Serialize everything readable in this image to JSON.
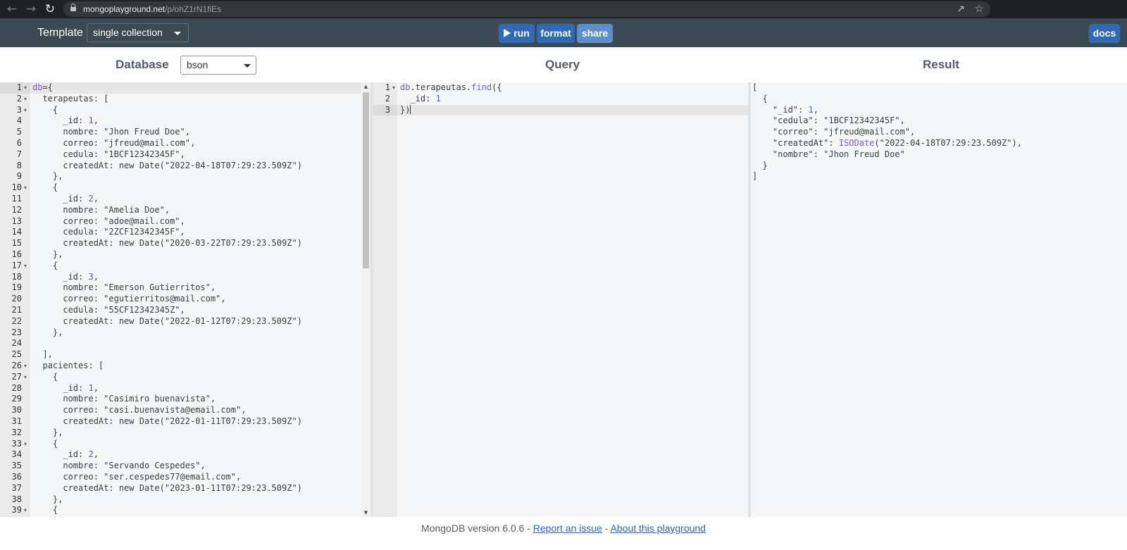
{
  "browser": {
    "url_host": "mongoplayground.net",
    "url_path": "/p/ohZ1rN1fiEs"
  },
  "toolbar": {
    "template_label": "Template",
    "template_value": "single collection",
    "run_label": "run",
    "format_label": "format",
    "share_label": "share",
    "docs_label": "docs"
  },
  "panels": {
    "database_title": "Database",
    "database_mode": "bson",
    "query_title": "Query",
    "result_title": "Result"
  },
  "database_editor": {
    "lines": [
      "db={",
      "  terapeutas: [",
      "    {",
      "      _id: 1,",
      "      nombre: \"Jhon Freud Doe\",",
      "      correo: \"jfreud@mail.com\",",
      "      cedula: \"1BCF12342345F\",",
      "      createdAt: new Date(\"2022-04-18T07:29:23.509Z\")",
      "    },",
      "    {",
      "      _id: 2,",
      "      nombre: \"Amelia Doe\",",
      "      correo: \"adoe@mail.com\",",
      "      cedula: \"2ZCF12342345F\",",
      "      createdAt: new Date(\"2020-03-22T07:29:23.509Z\")",
      "    },",
      "    {",
      "      _id: 3,",
      "      nombre: \"Emerson Gutierritos\",",
      "      correo: \"egutierritos@mail.com\",",
      "      cedula: \"55CF12342345Z\",",
      "      createdAt: new Date(\"2022-01-12T07:29:23.509Z\")",
      "    },",
      "",
      "  ],",
      "  pacientes: [",
      "    {",
      "      _id: 1,",
      "      nombre: \"Casimiro buenavista\",",
      "      correo: \"casi.buenavista@email.com\",",
      "      createdAt: new Date(\"2022-01-11T07:29:23.509Z\")",
      "    },",
      "    {",
      "      _id: 2,",
      "      nombre: \"Servando Cespedes\",",
      "      correo: \"ser.cespedes77@email.com\",",
      "      createdAt: new Date(\"2023-01-11T07:29:23.509Z\")",
      "    },",
      "    {"
    ],
    "fold_lines": [
      1,
      2,
      3,
      10,
      17,
      26,
      27,
      33,
      39
    ]
  },
  "query_editor": {
    "lines": [
      "db.terapeutas.find({",
      "  _id: 1",
      "})"
    ],
    "fold_lines": [
      1
    ]
  },
  "result_editor": {
    "lines": [
      "[",
      "  {",
      "    \"_id\": 1,",
      "    \"cedula\": \"1BCF12342345F\",",
      "    \"correo\": \"jfreud@mail.com\",",
      "    \"createdAt\": ISODate(\"2022-04-18T07:29:23.509Z\"),",
      "    \"nombre\": \"Jhon Freud Doe\"",
      "  }",
      "]"
    ]
  },
  "footer": {
    "version_text": "MongoDB version 6.0.6 -",
    "report_link": "Report an issue",
    "separator": "-",
    "about_link": "About this playground"
  }
}
